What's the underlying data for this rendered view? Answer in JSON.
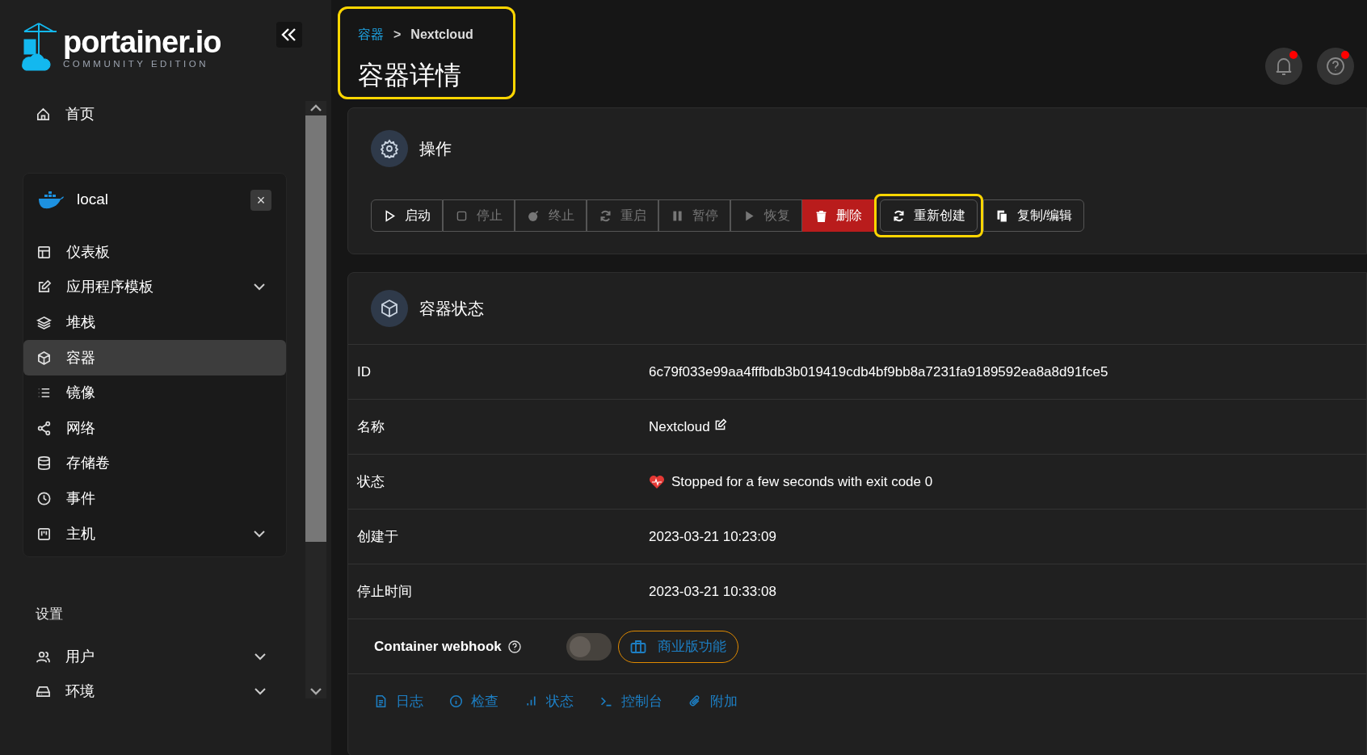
{
  "logo": {
    "name": "portainer.io",
    "edition": "COMMUNITY EDITION"
  },
  "sidebar": {
    "home": {
      "label": "首页",
      "selected": false
    },
    "environment": {
      "name": "local",
      "close": "×",
      "items": [
        {
          "label": "仪表板",
          "selected": false,
          "has_submenu": false
        },
        {
          "label": "应用程序模板",
          "selected": false,
          "has_submenu": true
        },
        {
          "label": "堆栈",
          "selected": false,
          "has_submenu": false
        },
        {
          "label": "容器",
          "selected": true,
          "has_submenu": false
        },
        {
          "label": "镜像",
          "selected": false,
          "has_submenu": false
        },
        {
          "label": "网络",
          "selected": false,
          "has_submenu": false
        },
        {
          "label": "存储卷",
          "selected": false,
          "has_submenu": false
        },
        {
          "label": "事件",
          "selected": false,
          "has_submenu": false
        },
        {
          "label": "主机",
          "selected": false,
          "has_submenu": true
        }
      ]
    },
    "settings": {
      "heading": "设置",
      "items": [
        {
          "label": "用户",
          "selected": false,
          "has_submenu": true
        },
        {
          "label": "环境",
          "selected": false,
          "has_submenu": true
        }
      ]
    }
  },
  "header": {
    "breadcrumb": [
      {
        "label": "容器",
        "link": true
      },
      {
        "label": "Nextcloud",
        "link": false
      }
    ],
    "separator": ">",
    "title": "容器详情",
    "highlighted": true,
    "notifications_dot": true,
    "help_dot": true
  },
  "actions": {
    "title": "操作",
    "buttons": [
      {
        "label": "启动",
        "kind": "default",
        "disabled": false,
        "highlighted": false
      },
      {
        "label": "停止",
        "kind": "default",
        "disabled": true,
        "highlighted": false
      },
      {
        "label": "终止",
        "kind": "default",
        "disabled": true,
        "highlighted": false
      },
      {
        "label": "重启",
        "kind": "default",
        "disabled": true,
        "highlighted": false
      },
      {
        "label": "暂停",
        "kind": "default",
        "disabled": true,
        "highlighted": false
      },
      {
        "label": "恢复",
        "kind": "default",
        "disabled": true,
        "highlighted": false
      },
      {
        "label": "删除",
        "kind": "danger",
        "disabled": false,
        "highlighted": false
      },
      {
        "label": "重新创建",
        "kind": "default",
        "disabled": false,
        "highlighted": true
      },
      {
        "label": "复制/编辑",
        "kind": "default",
        "disabled": false,
        "highlighted": false
      }
    ]
  },
  "status": {
    "title": "容器状态",
    "rows": [
      {
        "label": "ID",
        "value": "6c79f033e99aa4fffbdb3b019419cdb4bf9bb8a7231fa9189592ea8a8d91fce5",
        "kind": "text"
      },
      {
        "label": "名称",
        "value": "Nextcloud",
        "kind": "name"
      },
      {
        "label": "状态",
        "value": "Stopped for a few seconds with exit code 0",
        "kind": "health"
      },
      {
        "label": "创建于",
        "value": "2023-03-21 10:23:09",
        "kind": "text"
      },
      {
        "label": "停止时间",
        "value": "2023-03-21 10:33:08",
        "kind": "text"
      }
    ],
    "webhook": {
      "label": "Container webhook",
      "on": false,
      "badge": "商业版功能"
    },
    "links": [
      "日志",
      "检查",
      "状态",
      "控制台",
      "附加"
    ]
  }
}
